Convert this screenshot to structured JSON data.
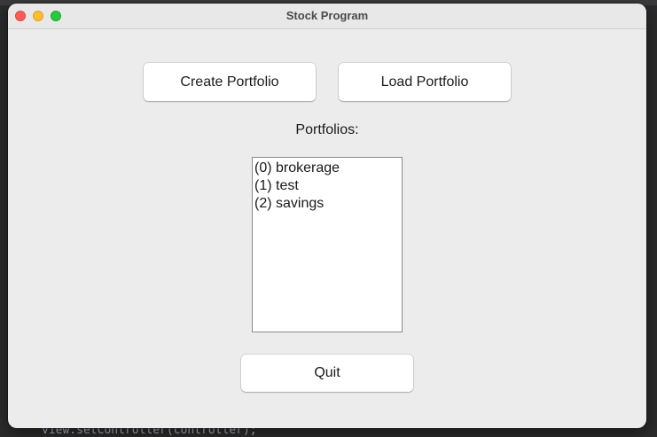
{
  "window": {
    "title": "Stock Program"
  },
  "buttons": {
    "create_label": "Create Portfolio",
    "load_label": "Load Portfolio",
    "quit_label": "Quit"
  },
  "portfolios": {
    "label": "Portfolios:",
    "items": [
      "(0) brokerage",
      "(1) test",
      "(2) savings"
    ]
  },
  "background": {
    "code_line": "view.setController(controller);"
  },
  "colors": {
    "close": "#ff5f57",
    "minimize": "#febc2e",
    "maximize": "#28c840",
    "window_bg": "#ececec"
  }
}
